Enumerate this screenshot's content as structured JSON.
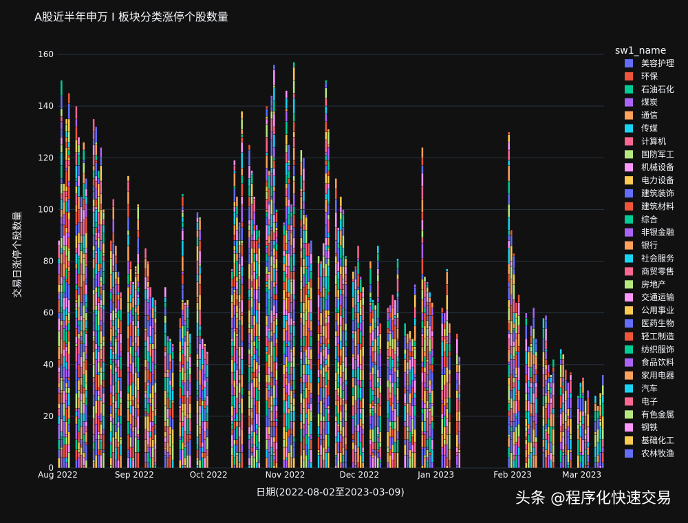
{
  "chart_data": {
    "type": "bar",
    "stacked": true,
    "title": "A股近半年申万 I 板块分类涨停个股数量",
    "xlabel": "日期(2022-08-02至2023-03-09)",
    "ylabel": "交易日涨停个股数量",
    "ylim": [
      0,
      160
    ],
    "yticks": [
      0,
      20,
      40,
      60,
      80,
      100,
      120,
      140,
      160
    ],
    "xticks": [
      {
        "label": "Aug 2022",
        "date": "2022-08-01"
      },
      {
        "label": "Sep 2022",
        "date": "2022-09-01"
      },
      {
        "label": "Oct 2022",
        "date": "2022-10-01"
      },
      {
        "label": "Nov 2022",
        "date": "2022-11-01"
      },
      {
        "label": "Dec 2022",
        "date": "2022-12-01"
      },
      {
        "label": "Jan 2023",
        "date": "2023-01-01"
      },
      {
        "label": "Feb 2023",
        "date": "2023-02-01"
      },
      {
        "label": "Mar 2023",
        "date": "2023-03-01"
      }
    ],
    "xrange": [
      "2022-08-01",
      "2023-03-10"
    ],
    "grid": true,
    "legend_title": "sw1_name",
    "legend_position": "right",
    "series": [
      {
        "name": "美容护理",
        "color": "#636efa"
      },
      {
        "name": "环保",
        "color": "#EF553B"
      },
      {
        "name": "石油石化",
        "color": "#00cc96"
      },
      {
        "name": "煤炭",
        "color": "#ab63fa"
      },
      {
        "name": "通信",
        "color": "#FFA15A"
      },
      {
        "name": "传媒",
        "color": "#19d3f3"
      },
      {
        "name": "计算机",
        "color": "#FF6692"
      },
      {
        "name": "国防军工",
        "color": "#B6E880"
      },
      {
        "name": "机械设备",
        "color": "#FF97FF"
      },
      {
        "name": "电力设备",
        "color": "#FECB52"
      },
      {
        "name": "建筑装饰",
        "color": "#636efa"
      },
      {
        "name": "建筑材料",
        "color": "#EF553B"
      },
      {
        "name": "综合",
        "color": "#00cc96"
      },
      {
        "name": "非银金融",
        "color": "#ab63fa"
      },
      {
        "name": "银行",
        "color": "#FFA15A"
      },
      {
        "name": "社会服务",
        "color": "#19d3f3"
      },
      {
        "name": "商贸零售",
        "color": "#FF6692"
      },
      {
        "name": "房地产",
        "color": "#B6E880"
      },
      {
        "name": "交通运输",
        "color": "#FF97FF"
      },
      {
        "name": "公用事业",
        "color": "#FECB52"
      },
      {
        "name": "医药生物",
        "color": "#636efa"
      },
      {
        "name": "轻工制造",
        "color": "#EF553B"
      },
      {
        "name": "纺织服饰",
        "color": "#00cc96"
      },
      {
        "name": "食品饮料",
        "color": "#ab63fa"
      },
      {
        "name": "家用电器",
        "color": "#FFA15A"
      },
      {
        "name": "汽车",
        "color": "#19d3f3"
      },
      {
        "name": "电子",
        "color": "#FF6692"
      },
      {
        "name": "有色金属",
        "color": "#B6E880"
      },
      {
        "name": "钢铁",
        "color": "#FF97FF"
      },
      {
        "name": "基础化工",
        "color": "#FECB52"
      },
      {
        "name": "农林牧渔",
        "color": "#636efa"
      }
    ],
    "daily_totals": [
      {
        "date": "2022-08-01",
        "total": 88
      },
      {
        "date": "2022-08-02",
        "total": 150
      },
      {
        "date": "2022-08-03",
        "total": 110
      },
      {
        "date": "2022-08-04",
        "total": 135
      },
      {
        "date": "2022-08-05",
        "total": 145
      },
      {
        "date": "2022-08-08",
        "total": 140
      },
      {
        "date": "2022-08-09",
        "total": 128
      },
      {
        "date": "2022-08-10",
        "total": 105
      },
      {
        "date": "2022-08-11",
        "total": 126
      },
      {
        "date": "2022-08-12",
        "total": 112
      },
      {
        "date": "2022-08-15",
        "total": 135
      },
      {
        "date": "2022-08-16",
        "total": 132
      },
      {
        "date": "2022-08-17",
        "total": 115
      },
      {
        "date": "2022-08-18",
        "total": 124
      },
      {
        "date": "2022-08-19",
        "total": 100
      },
      {
        "date": "2022-08-22",
        "total": 88
      },
      {
        "date": "2022-08-23",
        "total": 104
      },
      {
        "date": "2022-08-24",
        "total": 86
      },
      {
        "date": "2022-08-25",
        "total": 76
      },
      {
        "date": "2022-08-26",
        "total": 68
      },
      {
        "date": "2022-08-29",
        "total": 113
      },
      {
        "date": "2022-08-30",
        "total": 80
      },
      {
        "date": "2022-08-31",
        "total": 72
      },
      {
        "date": "2022-09-01",
        "total": 78
      },
      {
        "date": "2022-09-02",
        "total": 102
      },
      {
        "date": "2022-09-05",
        "total": 85
      },
      {
        "date": "2022-09-06",
        "total": 80
      },
      {
        "date": "2022-09-07",
        "total": 70
      },
      {
        "date": "2022-09-08",
        "total": 66
      },
      {
        "date": "2022-09-09",
        "total": 65
      },
      {
        "date": "2022-09-13",
        "total": 70
      },
      {
        "date": "2022-09-14",
        "total": 51
      },
      {
        "date": "2022-09-15",
        "total": 50
      },
      {
        "date": "2022-09-16",
        "total": 48
      },
      {
        "date": "2022-09-19",
        "total": 58
      },
      {
        "date": "2022-09-20",
        "total": 106
      },
      {
        "date": "2022-09-21",
        "total": 64
      },
      {
        "date": "2022-09-22",
        "total": 65
      },
      {
        "date": "2022-09-23",
        "total": 52
      },
      {
        "date": "2022-09-26",
        "total": 99
      },
      {
        "date": "2022-09-27",
        "total": 97
      },
      {
        "date": "2022-09-28",
        "total": 50
      },
      {
        "date": "2022-09-29",
        "total": 48
      },
      {
        "date": "2022-09-30",
        "total": 45
      },
      {
        "date": "2022-10-10",
        "total": 77
      },
      {
        "date": "2022-10-11",
        "total": 119
      },
      {
        "date": "2022-10-12",
        "total": 105
      },
      {
        "date": "2022-10-13",
        "total": 95
      },
      {
        "date": "2022-10-14",
        "total": 138
      },
      {
        "date": "2022-10-17",
        "total": 125
      },
      {
        "date": "2022-10-18",
        "total": 115
      },
      {
        "date": "2022-10-19",
        "total": 105
      },
      {
        "date": "2022-10-20",
        "total": 94
      },
      {
        "date": "2022-10-21",
        "total": 92
      },
      {
        "date": "2022-10-24",
        "total": 140
      },
      {
        "date": "2022-10-25",
        "total": 115
      },
      {
        "date": "2022-10-26",
        "total": 144
      },
      {
        "date": "2022-10-27",
        "total": 156
      },
      {
        "date": "2022-10-28",
        "total": 100
      },
      {
        "date": "2022-10-31",
        "total": 95
      },
      {
        "date": "2022-11-01",
        "total": 146
      },
      {
        "date": "2022-11-02",
        "total": 125
      },
      {
        "date": "2022-11-03",
        "total": 102
      },
      {
        "date": "2022-11-04",
        "total": 157
      },
      {
        "date": "2022-11-07",
        "total": 123
      },
      {
        "date": "2022-11-08",
        "total": 120
      },
      {
        "date": "2022-11-09",
        "total": 98
      },
      {
        "date": "2022-11-10",
        "total": 87
      },
      {
        "date": "2022-11-11",
        "total": 88
      },
      {
        "date": "2022-11-14",
        "total": 82
      },
      {
        "date": "2022-11-15",
        "total": 80
      },
      {
        "date": "2022-11-16",
        "total": 87
      },
      {
        "date": "2022-11-17",
        "total": 150
      },
      {
        "date": "2022-11-18",
        "total": 131
      },
      {
        "date": "2022-11-21",
        "total": 112
      },
      {
        "date": "2022-11-22",
        "total": 93
      },
      {
        "date": "2022-11-23",
        "total": 105
      },
      {
        "date": "2022-11-24",
        "total": 100
      },
      {
        "date": "2022-11-25",
        "total": 82
      },
      {
        "date": "2022-11-28",
        "total": 76
      },
      {
        "date": "2022-11-29",
        "total": 78
      },
      {
        "date": "2022-11-30",
        "total": 86
      },
      {
        "date": "2022-12-01",
        "total": 74
      },
      {
        "date": "2022-12-02",
        "total": 70
      },
      {
        "date": "2022-12-05",
        "total": 80
      },
      {
        "date": "2022-12-06",
        "total": 65
      },
      {
        "date": "2022-12-07",
        "total": 63
      },
      {
        "date": "2022-12-08",
        "total": 86
      },
      {
        "date": "2022-12-09",
        "total": 56
      },
      {
        "date": "2022-12-12",
        "total": 62
      },
      {
        "date": "2022-12-13",
        "total": 63
      },
      {
        "date": "2022-12-14",
        "total": 67
      },
      {
        "date": "2022-12-15",
        "total": 65
      },
      {
        "date": "2022-12-16",
        "total": 81
      },
      {
        "date": "2022-12-19",
        "total": 56
      },
      {
        "date": "2022-12-20",
        "total": 52
      },
      {
        "date": "2022-12-21",
        "total": 53
      },
      {
        "date": "2022-12-22",
        "total": 50
      },
      {
        "date": "2022-12-23",
        "total": 71
      },
      {
        "date": "2022-12-26",
        "total": 124
      },
      {
        "date": "2022-12-27",
        "total": 74
      },
      {
        "date": "2022-12-28",
        "total": 72
      },
      {
        "date": "2022-12-29",
        "total": 68
      },
      {
        "date": "2022-12-30",
        "total": 64
      },
      {
        "date": "2023-01-03",
        "total": 62
      },
      {
        "date": "2023-01-04",
        "total": 60
      },
      {
        "date": "2023-01-05",
        "total": 77
      },
      {
        "date": "2023-01-06",
        "total": 56
      },
      {
        "date": "2023-01-09",
        "total": 52
      },
      {
        "date": "2023-01-10",
        "total": 43
      },
      {
        "date": "2023-01-30",
        "total": 130
      },
      {
        "date": "2023-01-31",
        "total": 92
      },
      {
        "date": "2023-02-01",
        "total": 83
      },
      {
        "date": "2023-02-02",
        "total": 64
      },
      {
        "date": "2023-02-03",
        "total": 67
      },
      {
        "date": "2023-02-06",
        "total": 60
      },
      {
        "date": "2023-02-07",
        "total": 47
      },
      {
        "date": "2023-02-08",
        "total": 55
      },
      {
        "date": "2023-02-09",
        "total": 62
      },
      {
        "date": "2023-02-10",
        "total": 50
      },
      {
        "date": "2023-02-13",
        "total": 58
      },
      {
        "date": "2023-02-14",
        "total": 59
      },
      {
        "date": "2023-02-15",
        "total": 40
      },
      {
        "date": "2023-02-16",
        "total": 36
      },
      {
        "date": "2023-02-17",
        "total": 42
      },
      {
        "date": "2023-02-20",
        "total": 46
      },
      {
        "date": "2023-02-21",
        "total": 44
      },
      {
        "date": "2023-02-22",
        "total": 38
      },
      {
        "date": "2023-02-23",
        "total": 33
      },
      {
        "date": "2023-02-24",
        "total": 37
      },
      {
        "date": "2023-02-27",
        "total": 28
      },
      {
        "date": "2023-02-28",
        "total": 33
      },
      {
        "date": "2023-03-01",
        "total": 35
      },
      {
        "date": "2023-03-02",
        "total": 26
      },
      {
        "date": "2023-03-03",
        "total": 30
      },
      {
        "date": "2023-03-06",
        "total": 28
      },
      {
        "date": "2023-03-07",
        "total": 24
      },
      {
        "date": "2023-03-08",
        "total": 29
      },
      {
        "date": "2023-03-09",
        "total": 36
      }
    ]
  },
  "watermark": "头条 @程序化快速交易"
}
